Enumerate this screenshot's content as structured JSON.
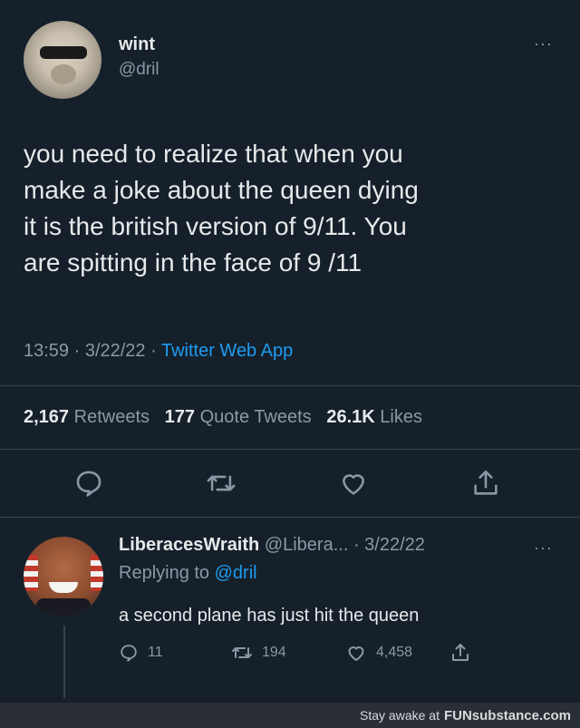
{
  "tweet": {
    "name": "wint",
    "handle": "@dril",
    "text": "you need to realize that when you\nmake a joke about the queen dying\nit is the british version of 9/11. You\nare spitting in the face of 9 /11",
    "time": "13:59 · 3/22/22 · ",
    "source": "Twitter Web App",
    "stats": {
      "retweets_count": "2,167",
      "retweets_label": "Retweets",
      "quotes_count": "177",
      "quotes_label": "Quote Tweets",
      "likes_count": "26.1K",
      "likes_label": "Likes"
    },
    "more": "···"
  },
  "reply": {
    "name": "LiberacesWraith",
    "handle_date": "@Libera... · 3/22/22",
    "replying_prefix": "Replying to ",
    "replying_to": "@dril",
    "text": "a second plane has just hit the queen",
    "reply_count": "11",
    "retweet_count": "194",
    "like_count": "4,458",
    "more": "···"
  },
  "footer": {
    "text": "Stay awake at",
    "brand": "FUNsubstance.com"
  },
  "colors": {
    "background": "#15202b",
    "accent": "#1d9bf0",
    "secondary_text": "#8b98a5"
  },
  "icons": [
    "reply-icon",
    "retweet-icon",
    "like-icon",
    "share-icon"
  ]
}
